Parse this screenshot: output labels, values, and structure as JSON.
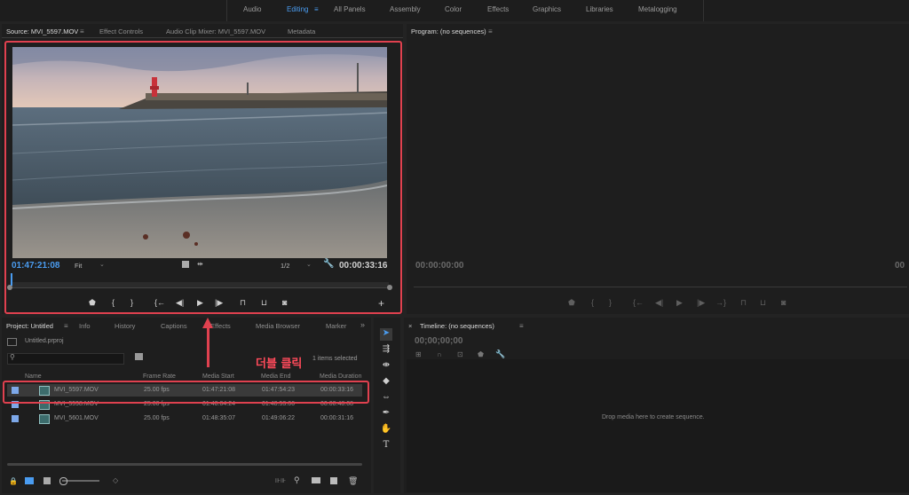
{
  "workspaces": [
    "Audio",
    "Editing",
    "All Panels",
    "Assembly",
    "Color",
    "Effects",
    "Graphics",
    "Libraries",
    "Metalogging"
  ],
  "active_workspace": "Editing",
  "source_panel": {
    "tabs": [
      "Source: MVI_5597.MOV",
      "Effect Controls",
      "Audio Clip Mixer: MVI_5597.MOV",
      "Metadata"
    ],
    "current_timecode": "01:47:21:08",
    "zoom": "Fit",
    "resolution": "1/2",
    "duration": "00:00:33:16"
  },
  "program_panel": {
    "title": "Program: (no sequences)",
    "timecode": "00:00:00:00",
    "right_timecode": "00"
  },
  "project_panel": {
    "tabs": [
      "Project: Untitled",
      "Info",
      "History",
      "Captions",
      "Effects",
      "Media Browser",
      "Marker"
    ],
    "file": "Untitled.prproj",
    "items_selected": "1 items selected",
    "columns": [
      "Name",
      "Frame Rate",
      "Media Start",
      "Media End",
      "Media Duration"
    ],
    "rows": [
      {
        "name": "MVI_5597.MOV",
        "fps": "25.00 fps",
        "start": "01:47:21:08",
        "end": "01:47:54:23",
        "duration": "00:00:33:16"
      },
      {
        "name": "MVI_5598.MOV",
        "fps": "25.00 fps",
        "start": "01:48:04:24",
        "end": "01:48:53:06",
        "duration": "00:00:48:08"
      },
      {
        "name": "MVI_5601.MOV",
        "fps": "25.00 fps",
        "start": "01:48:35:07",
        "end": "01:49:06:22",
        "duration": "00:00:31:16"
      }
    ]
  },
  "annotation": "더블 클릭",
  "timeline": {
    "title": "Timeline: (no sequences)",
    "timecode": "00;00;00;00",
    "placeholder": "Drop media here to create sequence."
  },
  "colors": {
    "accent": "#4a9cf0",
    "highlight": "#e0414f",
    "panel": "#1e1e1e"
  }
}
